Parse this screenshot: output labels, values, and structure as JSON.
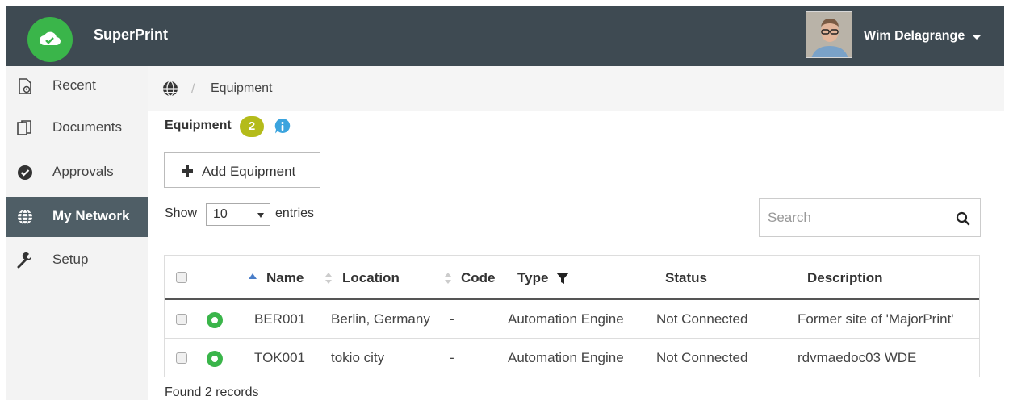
{
  "header": {
    "brand": "SuperPrint",
    "user_name": "Wim Delagrange"
  },
  "sidebar": {
    "items": [
      {
        "label": "Recent",
        "icon": "recent-document-icon"
      },
      {
        "label": "Documents",
        "icon": "documents-icon"
      },
      {
        "label": "Approvals",
        "icon": "approval-check-icon"
      },
      {
        "label": "My Network",
        "icon": "globe-icon",
        "active": true
      },
      {
        "label": "Setup",
        "icon": "wrench-icon"
      }
    ]
  },
  "breadcrumb": {
    "separator": "/",
    "current": "Equipment"
  },
  "content": {
    "title": "Equipment",
    "count": "2",
    "add_button": "Add Equipment",
    "show_label": "Show",
    "entries_value": "10",
    "entries_label": "entries",
    "search_placeholder": "Search",
    "found_text": "Found 2 records"
  },
  "table": {
    "columns": [
      "Name",
      "Location",
      "Code",
      "Type",
      "Status",
      "Description"
    ],
    "rows": [
      {
        "name": "BER001",
        "location": "Berlin, Germany",
        "code": "-",
        "type": "Automation Engine",
        "status": "Not Connected",
        "description": "Former site of 'MajorPrint'"
      },
      {
        "name": "TOK001",
        "location": "tokio city",
        "code": "-",
        "type": "Automation Engine",
        "status": "Not Connected",
        "description": "rdvmaedoc03 WDE"
      }
    ]
  },
  "colors": {
    "header_bg": "#3e4a52",
    "brand_green": "#3ab54a",
    "badge": "#b4bb1a",
    "info_blue": "#3ba4de",
    "active_nav": "#4f5e66"
  }
}
